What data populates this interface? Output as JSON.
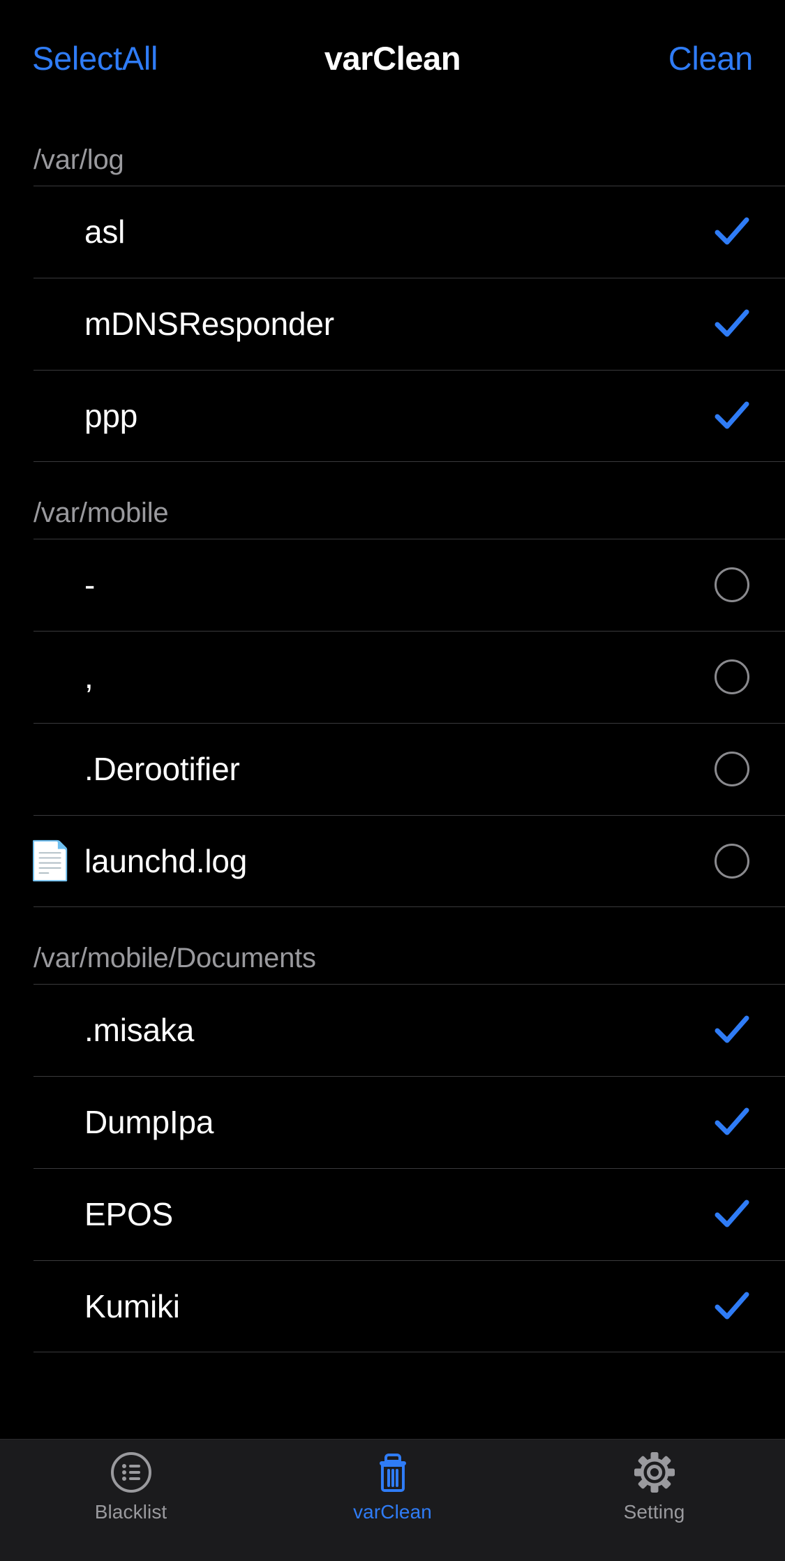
{
  "navbar": {
    "left_button": "SelectAll",
    "title": "varClean",
    "right_button": "Clean"
  },
  "colors": {
    "accent_blue": "#2f7cf6",
    "background": "#000000",
    "section_header_text": "#9a9a9e",
    "row_text": "#ffffff",
    "separator": "#3a3a3c",
    "unchecked_circle": "#8a8a8e",
    "tabbar_background": "#1b1b1d"
  },
  "sections": [
    {
      "header": "/var/log",
      "rows": [
        {
          "icon": "folder-icon",
          "label": "asl",
          "state": "checked"
        },
        {
          "icon": "folder-icon",
          "label": "mDNSResponder",
          "state": "checked"
        },
        {
          "icon": "folder-icon",
          "label": "ppp",
          "state": "checked"
        }
      ]
    },
    {
      "header": "/var/mobile",
      "rows": [
        {
          "icon": "folder-icon",
          "label": "-",
          "state": "unchecked"
        },
        {
          "icon": "folder-icon",
          "label": ",",
          "state": "unchecked"
        },
        {
          "icon": "folder-icon",
          "label": ".Derootifier",
          "state": "unchecked"
        },
        {
          "icon": "document-icon",
          "label": "launchd.log",
          "state": "unchecked"
        }
      ]
    },
    {
      "header": "/var/mobile/Documents",
      "rows": [
        {
          "icon": "folder-icon",
          "label": ".misaka",
          "state": "checked"
        },
        {
          "icon": "folder-icon",
          "label": "DumpIpa",
          "state": "checked"
        },
        {
          "icon": "folder-icon",
          "label": "EPOS",
          "state": "checked"
        },
        {
          "icon": "folder-icon",
          "label": "Kumiki",
          "state": "checked"
        }
      ]
    }
  ],
  "tabbar": {
    "tabs": [
      {
        "icon": "list-circle-icon",
        "label": "Blacklist",
        "active": false
      },
      {
        "icon": "trash-icon",
        "label": "varClean",
        "active": true
      },
      {
        "icon": "gear-icon",
        "label": "Setting",
        "active": false
      }
    ]
  },
  "icon_glyphs": {
    "folder-icon": "🗂",
    "document-icon": "📄"
  }
}
